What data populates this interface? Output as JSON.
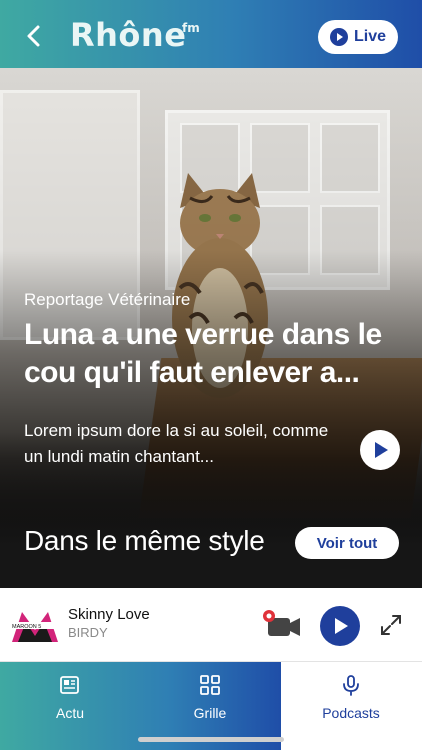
{
  "header": {
    "logo_text": "Rhône",
    "logo_sup": "fm",
    "live_label": "Live"
  },
  "hero": {
    "category": "Reportage Vétérinaire",
    "title": "Luna a une verrue dans le cou qu'il faut enlever a...",
    "description": "Lorem ipsum dore la si au soleil, comme un lundi matin chantant..."
  },
  "section": {
    "title": "Dans le même style",
    "see_all_label": "Voir tout"
  },
  "player": {
    "track_title": "Skinny Love",
    "track_artist": "BIRDY",
    "album_label": "MAROON 5"
  },
  "nav": {
    "items": [
      {
        "label": "Actu",
        "icon": "newspaper-icon"
      },
      {
        "label": "Grille",
        "icon": "grid-icon"
      },
      {
        "label": "Podcasts",
        "icon": "microphone-icon"
      }
    ],
    "active_index": 2
  },
  "colors": {
    "brand_blue": "#1f3f9c",
    "gradient_start": "#3fa9a2",
    "gradient_end": "#1f4ea8"
  }
}
